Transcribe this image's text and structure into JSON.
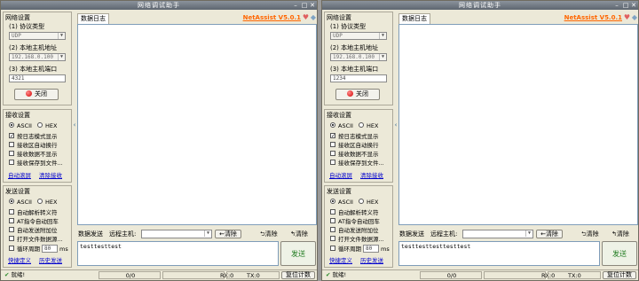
{
  "app": {
    "title": "网络调试助手",
    "brand": "NetAssist V5.0.1",
    "tab_log": "数据日志",
    "spin_arrow": "‹"
  },
  "colors": {
    "brand": "#ff6600",
    "link": "#0000cc",
    "send_green": "#1e7a1e"
  },
  "net": {
    "group_title": "网络设置",
    "protocol_label": "(1) 协议类型",
    "protocol_value": "UDP",
    "host_label": "(2) 本地主机地址",
    "host_value": "192.168.0.100",
    "port_label": "(3) 本地主机端口",
    "close_label": "关闭"
  },
  "recv": {
    "group_title": "接收设置",
    "ascii": "ASCII",
    "hex": "HEX",
    "options": [
      "按日志模式显示",
      "接收区自动换行",
      "接收数据不显示",
      "接收保存到文件..."
    ],
    "auto_scroll": "自动滚屏",
    "clear_recv": "清除接收"
  },
  "send": {
    "group_title": "发送设置",
    "ascii": "ASCII",
    "hex": "HEX",
    "options": [
      "自动解析转义符",
      "AT指令自动回车",
      "自动发送附加位",
      "打开文件数据源..."
    ],
    "loop_label": "循环周期",
    "loop_value": "80",
    "loop_unit": "ms",
    "shortcut": "快捷定义",
    "history": "历史发送"
  },
  "toolbar": {
    "send_label": "数据发送",
    "remote_label": "远程主机:",
    "clear_label": "清除",
    "clear_btn1": "清除",
    "clear_btn2": "清除",
    "send_button": "发送"
  },
  "status": {
    "ready": "就绪!",
    "counter": "0/0",
    "rx": "RX:0",
    "tx": "TX:0",
    "reset": "复位计数"
  },
  "windows": [
    {
      "port_value": "4321",
      "send_text": "testtesttest"
    },
    {
      "port_value": "1234",
      "send_text": "testtesttesttesttest"
    }
  ]
}
